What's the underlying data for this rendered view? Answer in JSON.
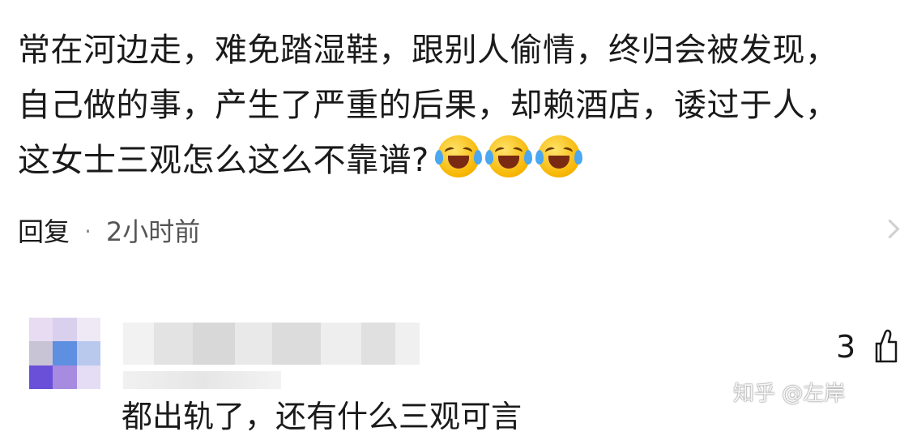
{
  "comment": {
    "lines": [
      "常在河边走，难免踏湿鞋，跟别人偷情，终归会被发现，",
      "自己做的事，产生了严重的后果，却赖酒店，诿过于人，",
      "这女士三观怎么这么不靠谱?"
    ],
    "emojis": [
      "laughing-tears-icon",
      "laughing-tears-icon",
      "laughing-tears-icon"
    ]
  },
  "meta": {
    "reply_label": "回复",
    "separator": "·",
    "time_ago": "2小时前"
  },
  "reply": {
    "like_count": "3",
    "text": "都出轨了，还有什么三观可言"
  },
  "watermark": "知乎 @左岸",
  "colors": {
    "text": "#1a1a1a",
    "muted": "#8a8a8a",
    "emoji_yellow": "#f7b500"
  }
}
